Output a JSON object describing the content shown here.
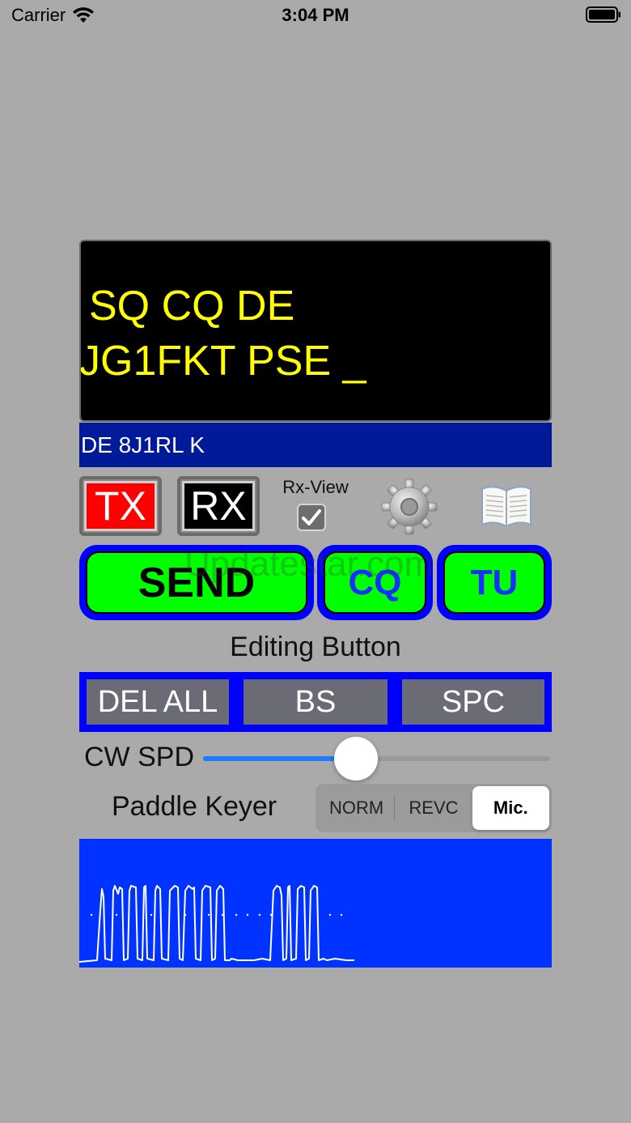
{
  "status_bar": {
    "carrier": "Carrier",
    "time": "3:04 PM"
  },
  "decoder": {
    "line1": "SQ CQ DE",
    "line2": "JG1FKT PSE _"
  },
  "message": "DE 8J1RL K",
  "controls": {
    "tx_label": "TX",
    "rx_label": "RX",
    "rx_view_label": "Rx-View",
    "rx_view_checked": true
  },
  "macros": {
    "send": "SEND",
    "cq": "CQ",
    "tu": "TU"
  },
  "watermark": "Updatestar.com",
  "editing": {
    "title": "Editing Button",
    "buttons": [
      "DEL ALL",
      "BS",
      "SPC"
    ]
  },
  "speed": {
    "label": "CW SPD",
    "value": 0.44
  },
  "keyer": {
    "label": "Paddle Keyer",
    "options": [
      "NORM",
      "REVC",
      "Mic."
    ],
    "selected": "Mic."
  },
  "colors": {
    "background": "#aaaaaa",
    "decoder_text": "#ffff00",
    "message_bar": "#001a99",
    "tx": "#ff0000",
    "macro_face": "#00ff00",
    "macro_border": "#0000ff",
    "waveform_bg": "#0033ff"
  }
}
